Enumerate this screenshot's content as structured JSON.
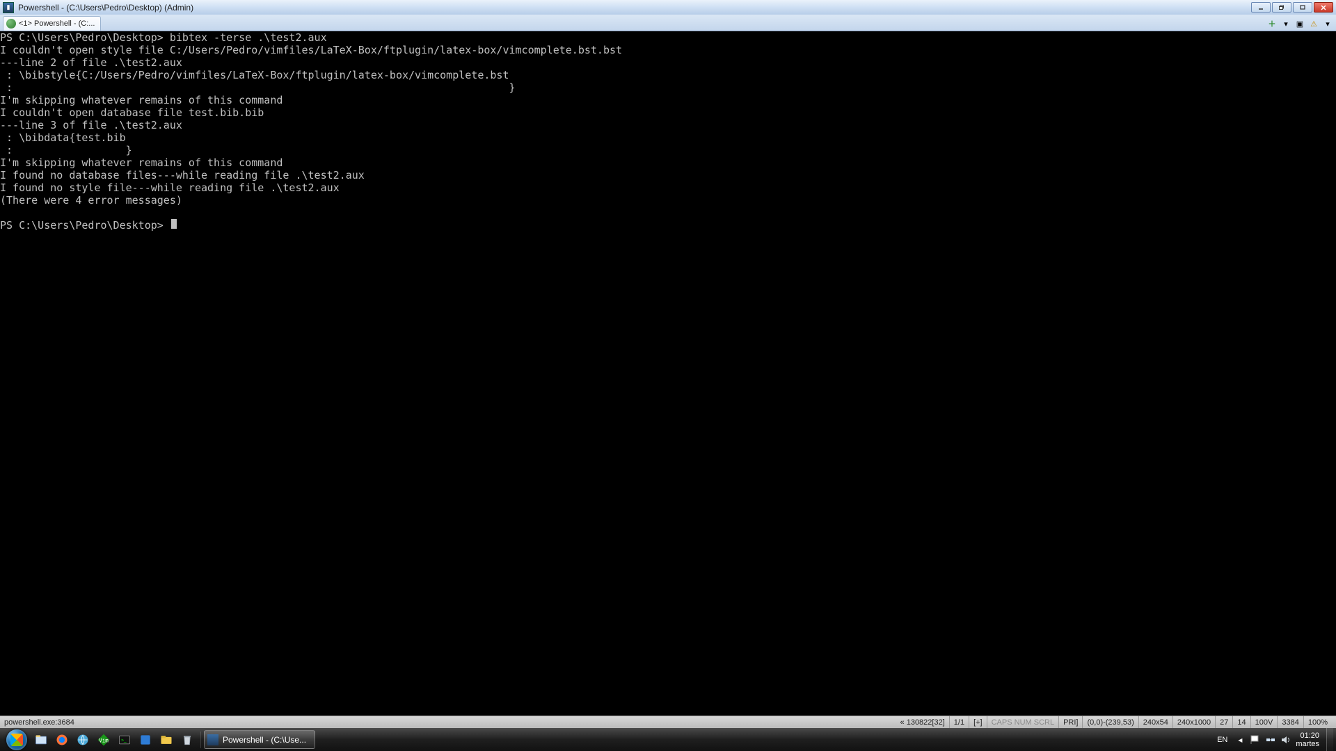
{
  "window": {
    "title": "Powershell - (C:\\Users\\Pedro\\Desktop) (Admin)"
  },
  "tab": {
    "label": "<1> Powershell - (C:..."
  },
  "terminal": {
    "lines": [
      "PS C:\\Users\\Pedro\\Desktop> bibtex -terse .\\test2.aux",
      "I couldn't open style file C:/Users/Pedro/vimfiles/LaTeX-Box/ftplugin/latex-box/vimcomplete.bst.bst",
      "---line 2 of file .\\test2.aux",
      " : \\bibstyle{C:/Users/Pedro/vimfiles/LaTeX-Box/ftplugin/latex-box/vimcomplete.bst",
      " :                                                                               }",
      "I'm skipping whatever remains of this command",
      "I couldn't open database file test.bib.bib",
      "---line 3 of file .\\test2.aux",
      " : \\bibdata{test.bib",
      " :                  }",
      "I'm skipping whatever remains of this command",
      "I found no database files---while reading file .\\test2.aux",
      "I found no style file---while reading file .\\test2.aux",
      "(There were 4 error messages)"
    ],
    "prompt": "PS C:\\Users\\Pedro\\Desktop>"
  },
  "status": {
    "left": "powershell.exe:3684",
    "buf": "« 130822[32]",
    "pos": "1/1",
    "mod": "[+]",
    "caps": "CAPS NUM SCRL",
    "pri": "PRI]",
    "coords": "(0,0)-(239,53)",
    "sizeA": "240x54",
    "sizeB": "240x1000",
    "c1": "27",
    "c2": "14",
    "c3": "100V",
    "c4": "3384",
    "c5": "100%"
  },
  "taskbar": {
    "active": "Powershell - (C:\\Use...",
    "lang": "EN",
    "time": "01:20",
    "day": "martes"
  }
}
